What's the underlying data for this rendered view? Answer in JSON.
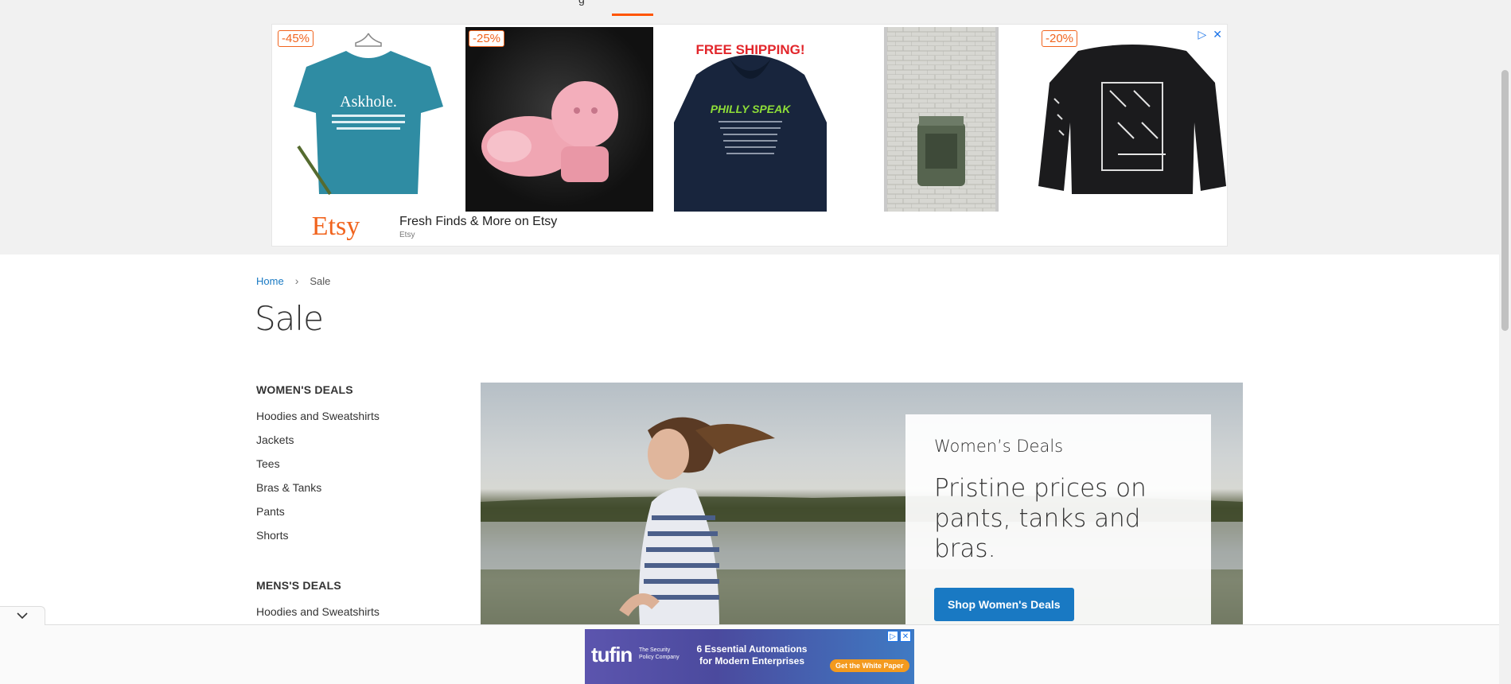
{
  "nav": {
    "partial_text": "g"
  },
  "etsy_ad": {
    "products": [
      {
        "discount": "-45%",
        "art_text": "Askhole."
      },
      {
        "discount": "-25%"
      },
      {
        "banner": "FREE SHIPPING!",
        "art_text": "PHILLY SPEAK"
      },
      {},
      {
        "discount": "-20%"
      }
    ],
    "logo": "Etsy",
    "title": "Fresh Finds & More on Etsy",
    "source": "Etsy"
  },
  "breadcrumb": {
    "home": "Home",
    "current": "Sale"
  },
  "page_title": "Sale",
  "sidebar": {
    "sections": [
      {
        "title": "WOMEN'S DEALS",
        "items": [
          "Hoodies and Sweatshirts",
          "Jackets",
          "Tees",
          "Bras & Tanks",
          "Pants",
          "Shorts"
        ]
      },
      {
        "title": "MENS'S DEALS",
        "items": [
          "Hoodies and Sweatshirts"
        ]
      }
    ]
  },
  "hero": {
    "kicker": "Women’s Deals",
    "headline": "Pristine prices on pants, tanks and bras.",
    "button": "Shop Women's Deals"
  },
  "bottom_ad": {
    "logo": "tufin",
    "tagline": "The Security Policy Company",
    "headline": "6 Essential Automations for Modern Enterprises",
    "cta": "Get the White Paper"
  },
  "colors": {
    "accent": "#ff5501",
    "link": "#1979c3",
    "etsy": "#f1641e",
    "button": "#1979c3"
  }
}
